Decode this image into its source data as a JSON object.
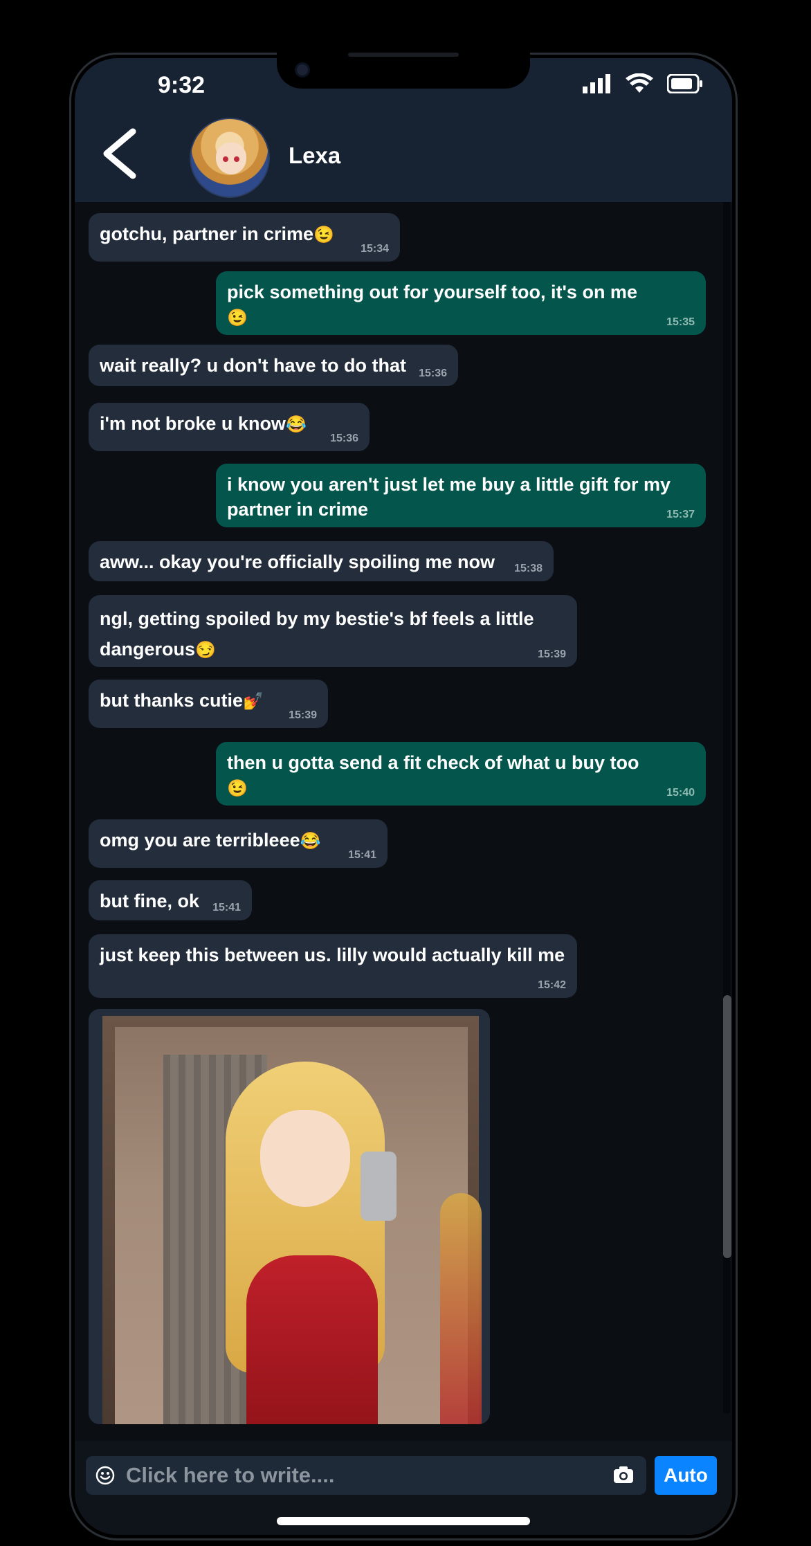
{
  "status_bar": {
    "time": "9:32"
  },
  "header": {
    "contact_name": "Lexa"
  },
  "messages": [
    {
      "dir": "in",
      "text": "gotchu, partner in crime",
      "emoji": "😉",
      "time": "15:34"
    },
    {
      "dir": "out",
      "text": "pick something out for yourself too, it's on me",
      "emoji": "😉",
      "time": "15:35"
    },
    {
      "dir": "in",
      "text": "wait really? u don't have to do that",
      "emoji": "",
      "time": "15:36"
    },
    {
      "dir": "in",
      "text": "i'm not broke u know",
      "emoji": "😂",
      "time": "15:36"
    },
    {
      "dir": "out",
      "text": "i know you aren't just let me buy a little gift for my partner in crime",
      "emoji": "",
      "time": "15:37"
    },
    {
      "dir": "in",
      "text": "aww... okay you're officially spoiling me now",
      "emoji": "",
      "time": "15:38"
    },
    {
      "dir": "in",
      "text": "ngl, getting spoiled by my bestie's bf feels a little dangerous",
      "emoji": "😏",
      "time": "15:39"
    },
    {
      "dir": "in",
      "text": "but thanks cutie",
      "emoji": "💅",
      "time": "15:39"
    },
    {
      "dir": "out",
      "text": "then u gotta send a fit check of what u buy too",
      "emoji": "😉",
      "time": "15:40"
    },
    {
      "dir": "in",
      "text": "omg you are terribleee",
      "emoji": "😂",
      "time": "15:41"
    },
    {
      "dir": "in",
      "text": "but fine, ok",
      "emoji": "",
      "time": "15:41"
    },
    {
      "dir": "in",
      "text": "just keep this between us. lilly would actually kill me",
      "emoji": "",
      "time": "15:42"
    }
  ],
  "composer": {
    "placeholder": "Click here to write....",
    "auto_label": "Auto"
  }
}
